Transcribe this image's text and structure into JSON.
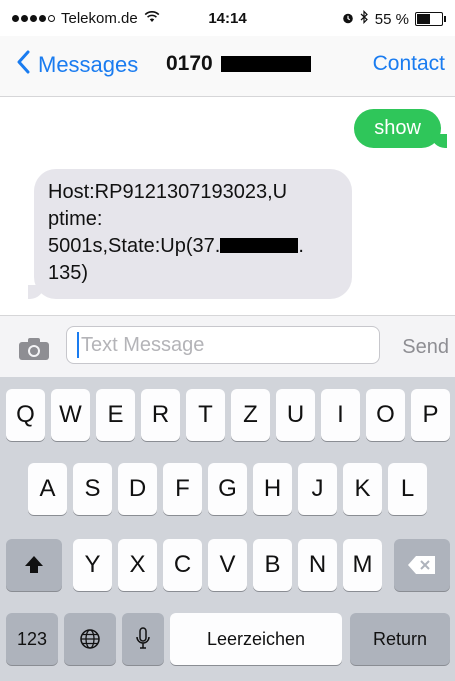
{
  "status_bar": {
    "carrier": "Telekom.de",
    "time": "14:14",
    "battery_percent_label": "55 %",
    "battery_level": 0.55,
    "signal_bars": 4
  },
  "nav": {
    "back_label": "Messages",
    "title_visible": "0170",
    "contact_label": "Contact"
  },
  "messages": [
    {
      "direction": "sent",
      "text": "show",
      "color": "#2fc65a"
    },
    {
      "direction": "received",
      "lines": [
        "Host:RP9121307193023,U",
        "ptime:",
        "5001s,State:Up(37.",
        ".",
        "135)"
      ],
      "color": "#e6e5eb"
    }
  ],
  "compose": {
    "placeholder": "Text Message",
    "send_label": "Send"
  },
  "keyboard": {
    "row1": [
      "Q",
      "W",
      "E",
      "R",
      "T",
      "Z",
      "U",
      "I",
      "O",
      "P"
    ],
    "row2": [
      "A",
      "S",
      "D",
      "F",
      "G",
      "H",
      "J",
      "K",
      "L"
    ],
    "row3": [
      "Y",
      "X",
      "C",
      "V",
      "B",
      "N",
      "M"
    ],
    "numbers_label": "123",
    "space_label": "Leerzeichen",
    "return_label": "Return"
  },
  "colors": {
    "accent": "#1a7cf0",
    "sent_bubble": "#2fc65a",
    "received_bubble": "#e6e5eb",
    "keyboard_bg": "#d1d4da"
  },
  "icons": [
    "wifi-icon",
    "alarm-icon",
    "bluetooth-icon",
    "battery-icon",
    "back-chevron-icon",
    "camera-icon",
    "shift-icon",
    "delete-icon",
    "globe-icon",
    "microphone-icon"
  ]
}
